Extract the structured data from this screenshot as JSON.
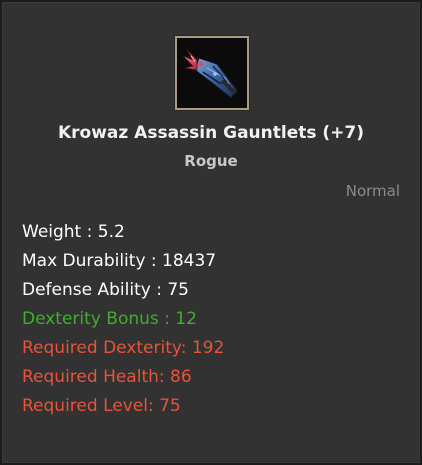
{
  "item": {
    "icon": "gauntlet-icon",
    "name": "Krowaz Assassin Gauntlets (+7)",
    "class": "Rogue",
    "grade": "Normal"
  },
  "stats": [
    {
      "text": "Weight : 5.2",
      "color": "#ffffff"
    },
    {
      "text": "Max Durability : 18437",
      "color": "#ffffff"
    },
    {
      "text": "Defense Ability : 75",
      "color": "#ffffff"
    },
    {
      "text": "Dexterity Bonus : 12",
      "color": "#3fae2d"
    },
    {
      "text": "Required Dexterity: 192",
      "color": "#e8533a"
    },
    {
      "text": "Required Health: 86",
      "color": "#e8533a"
    },
    {
      "text": "Required Level: 75",
      "color": "#e8533a"
    }
  ]
}
